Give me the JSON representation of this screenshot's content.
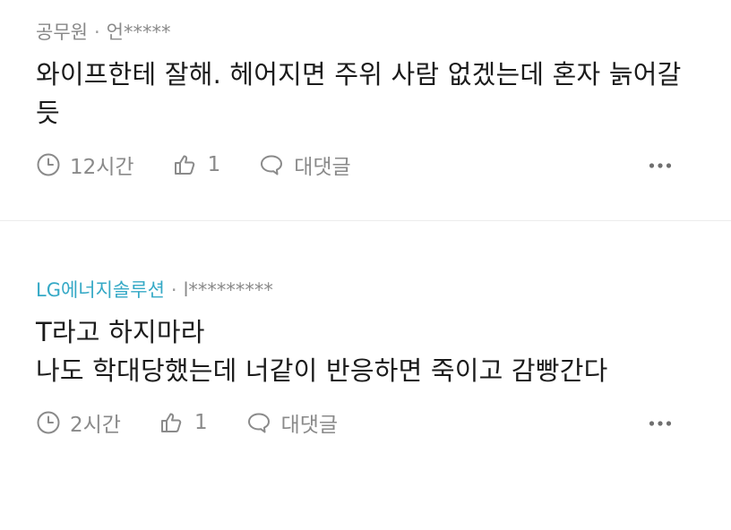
{
  "comments": [
    {
      "company": "공무원",
      "username": "언*****",
      "text": "와이프한테 잘해. 헤어지면 주위 사람 없겠는데 혼자 늙어갈\n듯",
      "time": "12시간",
      "likes": "1",
      "reply_label": "대댓글"
    },
    {
      "company": "LG에너지솔루션",
      "username": "l*********",
      "text": "T라고 하지마라\n나도 학대당했는데 너같이 반응하면 죽이고 감빵간다",
      "time": "2시간",
      "likes": "1",
      "reply_label": "대댓글"
    }
  ],
  "meta_separator": "·",
  "colors": {
    "accent": "#35a9c6",
    "meta": "#8a8a8a",
    "text": "#1b1b1b",
    "divider": "#ececec"
  },
  "icons": {
    "time": "clock-icon",
    "like": "thumbs-up-icon",
    "reply": "speech-bubble-icon",
    "more": "more-dots-icon"
  }
}
